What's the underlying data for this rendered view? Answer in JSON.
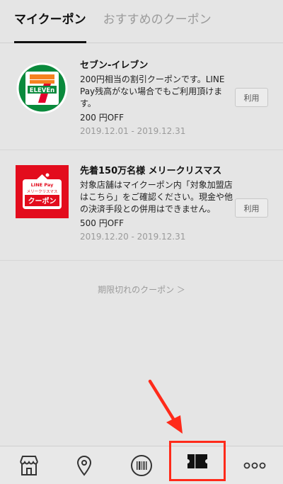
{
  "tabs": {
    "my_coupons": "マイクーポン",
    "recommended": "おすすめのクーポン"
  },
  "coupons": [
    {
      "brand_logo_text": "ELEVEn",
      "title": "セブン-イレブン",
      "description": "200円相当の割引クーポンです。LINE Pay残高がない場合でもご利用頂けます。",
      "amount": "200 円OFF",
      "period": "2019.12.01 - 2019.12.31",
      "button_label": "利用"
    },
    {
      "logo_line1": "LINE Pay",
      "logo_line2": "メリークリスマス",
      "logo_line3": "クーポン",
      "title": "先着150万名様 メリークリスマス",
      "description": "対象店舗はマイクーポン内「対象加盟店はこちら」をご確認ください。現金や他の決済手段との併用はできません。",
      "amount": "500 円OFF",
      "period": "2019.12.20 - 2019.12.31",
      "button_label": "利用"
    }
  ],
  "expired_link": "期限切れのクーポン ＞",
  "colors": {
    "annotation_red": "#ff2a1a",
    "seven_green": "#0a8a3c",
    "seven_orange": "#f5821f",
    "seven_red": "#e4002b",
    "linepay_red": "#e30c1d"
  },
  "nav_icons": [
    "store-icon",
    "location-pin-icon",
    "barcode-icon",
    "ticket-icon",
    "more-dots-icon"
  ]
}
